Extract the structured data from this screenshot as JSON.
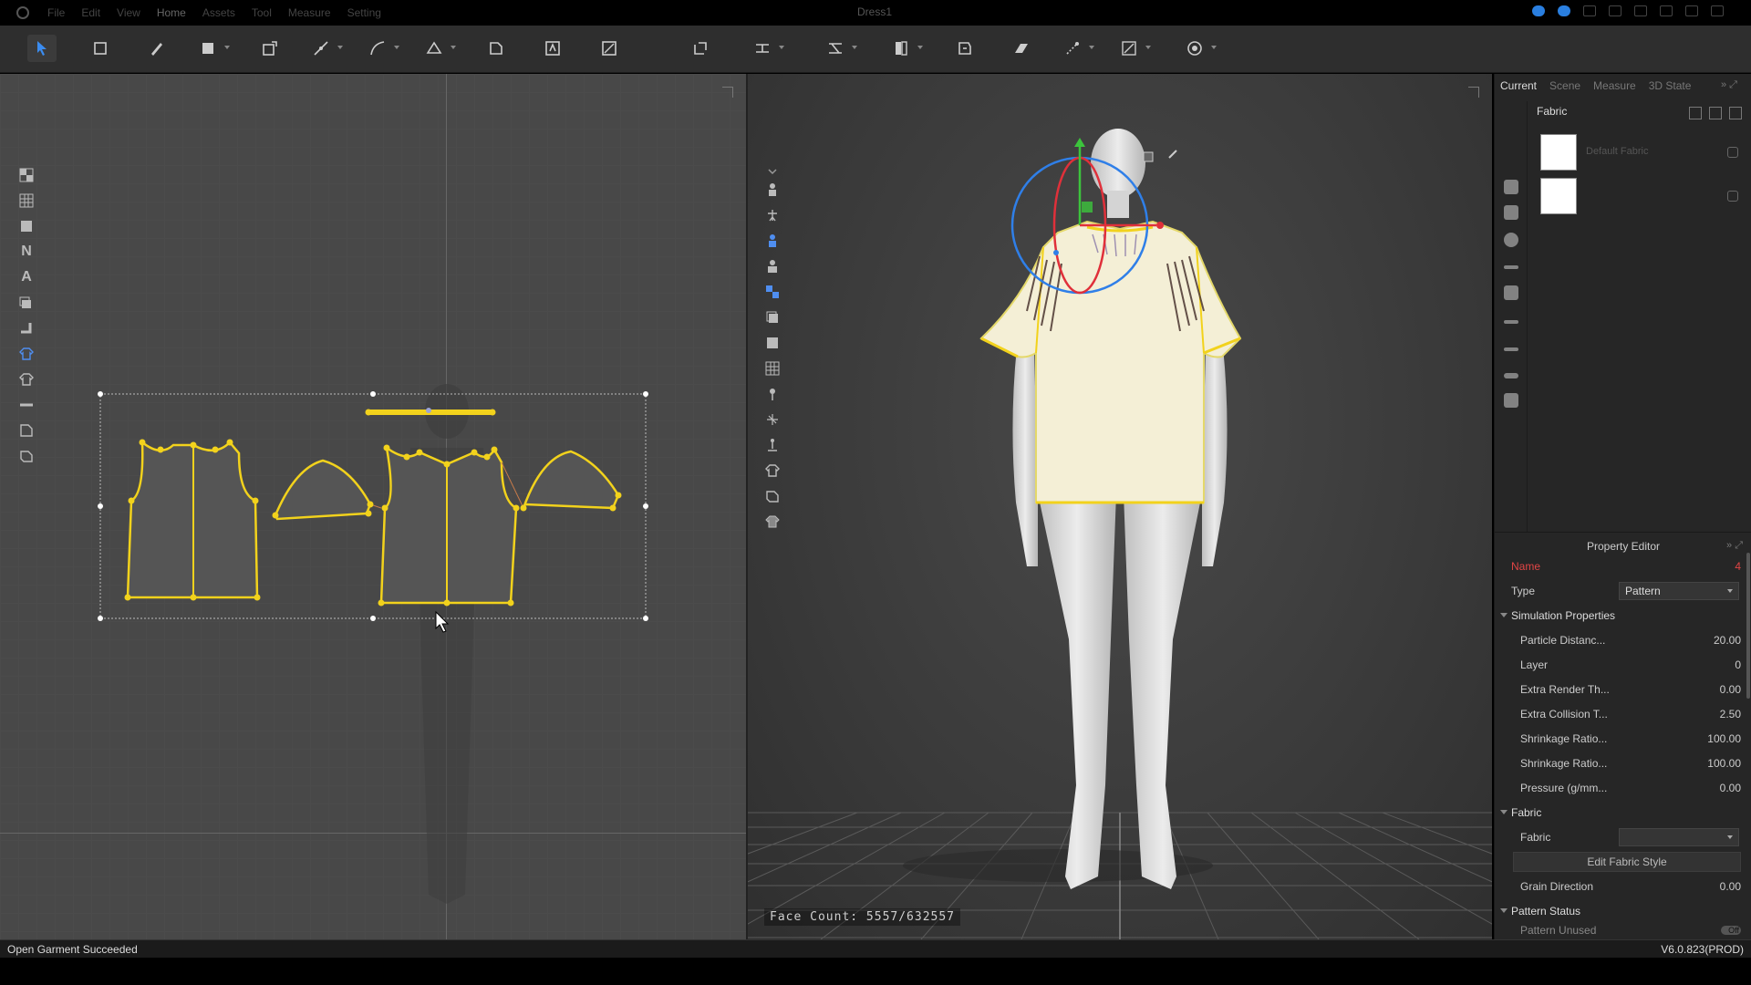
{
  "titlebar": {
    "menu": [
      "File",
      "Edit",
      "View",
      "Home",
      "Assets",
      "Tool",
      "Measure",
      "Setting"
    ],
    "document_title": "Dress1"
  },
  "panel2d": {},
  "panel3d": {
    "face_count": "Face Count: 5557/632557"
  },
  "right_panel": {
    "tabs": [
      "Current",
      "Scene",
      "Measure",
      "3D State"
    ],
    "library_title": "Fabric",
    "fabrics": [
      {
        "name": "Default Fabric"
      },
      {
        "name": ""
      }
    ]
  },
  "property_editor": {
    "title": "Property Editor",
    "name_label": "Name",
    "name_value": "4",
    "type_label": "Type",
    "type_value": "Pattern",
    "simulation_section": "Simulation Properties",
    "rows": [
      {
        "label": "Particle Distanc...",
        "value": "20.00"
      },
      {
        "label": "Layer",
        "value": "0"
      },
      {
        "label": "Extra Render Th...",
        "value": "0.00"
      },
      {
        "label": "Extra Collision T...",
        "value": "2.50"
      },
      {
        "label": "Shrinkage Ratio...",
        "value": "100.00"
      },
      {
        "label": "Shrinkage Ratio...",
        "value": "100.00"
      },
      {
        "label": "Pressure (g/mm...",
        "value": "0.00"
      }
    ],
    "fabric_section": "Fabric",
    "fabric_label": "Fabric",
    "fabric_value": "",
    "edit_fabric_style": "Edit Fabric Style",
    "grain_direction_label": "Grain Direction",
    "grain_direction_value": "0.00",
    "pattern_status_section": "Pattern Status",
    "pattern_unused_label": "Pattern Unused",
    "pattern_unused_value": "Off"
  },
  "statusbar": {
    "message": "Open Garment Succeeded",
    "version": "V6.0.823(PROD)"
  },
  "colors": {
    "pattern_outline": "#f2d21c",
    "garment_fill": "#f4efd6",
    "gizmo_blue": "#2f7fe8",
    "gizmo_red": "#e0303a",
    "gizmo_green": "#3cc43c",
    "selection_arrow": "#2e7fe8"
  }
}
